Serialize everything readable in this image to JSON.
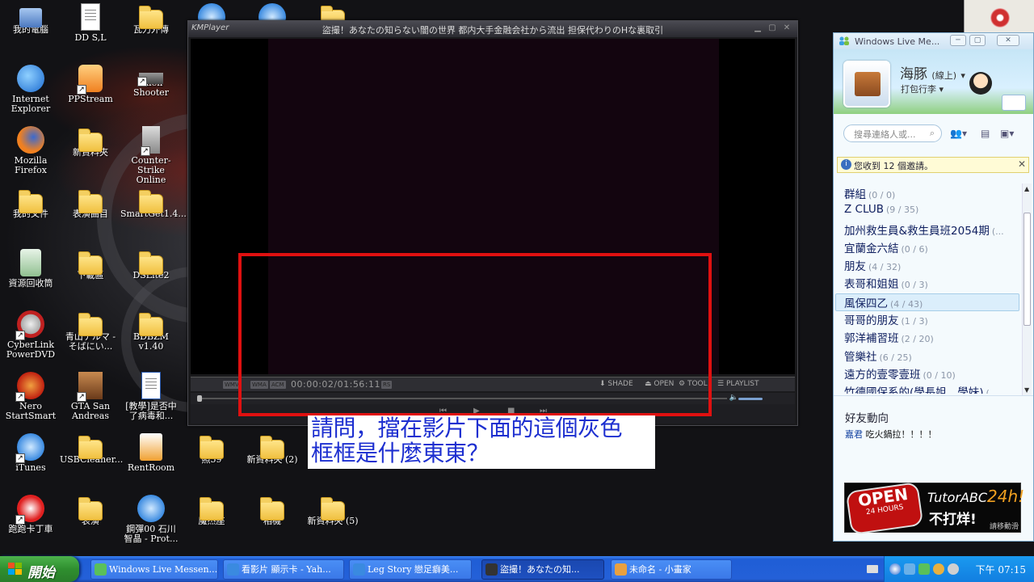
{
  "desktop": {
    "icons": [
      {
        "label": "我的電腦"
      },
      {
        "label": "DD S,L"
      },
      {
        "label": "瓦力外傳"
      },
      {
        "label": "Internet\nExplorer"
      },
      {
        "label": "PPStream"
      },
      {
        "label": "Alien Shooter"
      },
      {
        "label": "Mozilla\nFirefox"
      },
      {
        "label": "新資料夾"
      },
      {
        "label": "Counter-Strike\nOnline"
      },
      {
        "label": "我的文件"
      },
      {
        "label": "表演曲目"
      },
      {
        "label": "SmartGet1.4..."
      },
      {
        "label": "資源回收筒"
      },
      {
        "label": "下載區"
      },
      {
        "label": "DSLite2"
      },
      {
        "label": "CyberLink\nPowerDVD"
      },
      {
        "label": "青山テルマ -\nそばにい..."
      },
      {
        "label": "BDBZM v1.40"
      },
      {
        "label": "Nero\nStartSmart"
      },
      {
        "label": "GTA San\nAndreas"
      },
      {
        "label": "[教學]是否中\n了病毒和..."
      },
      {
        "label": "iTunes"
      },
      {
        "label": "USBCleaner..."
      },
      {
        "label": "RentRoom"
      },
      {
        "label": "照59"
      },
      {
        "label": "新資料夾 (2)"
      },
      {
        "label": "跑跑卡丁車"
      },
      {
        "label": "表演"
      },
      {
        "label": "鋼彈00 石川\n智晶 - Prot..."
      },
      {
        "label": "魔杰座"
      },
      {
        "label": "相機"
      },
      {
        "label": "新資料夾 (5)"
      }
    ]
  },
  "kmplayer": {
    "logo": "KMPlayer",
    "title": "盜撮！あなたの知らない闇の世界 都内大手金融会社から流出 担保代わりのHな裏取引",
    "tags": [
      "WMV",
      "WMA",
      "ACM"
    ],
    "time": "00:00:02/01:56:11",
    "tag_rs": "RS",
    "buttons": {
      "shade": "SHADE",
      "open": "OPEN",
      "tool": "TOOL",
      "playlist": "PLAYLIST"
    },
    "playback_position": 0.0003
  },
  "annotation": {
    "line1": "請問，擋在影片下面的這個灰色",
    "line2": "框框是什麼東東？",
    "color": "#e01010"
  },
  "messenger": {
    "title": "Windows Live Me...",
    "name": "海豚",
    "status_online": "(線上)",
    "personal_msg": "打包行李",
    "search_placeholder": "搜尋連絡人或...",
    "notice": "您收到 12 個邀請。",
    "groups": [
      {
        "name": "群組",
        "count": "(0 / 0)"
      },
      {
        "name": "Z CLUB",
        "count": "(9 / 35)"
      },
      {
        "name": "加州救生員&救生員班2054期",
        "count": "(..."
      },
      {
        "name": "宜蘭金六結",
        "count": "(0 / 6)"
      },
      {
        "name": "朋友",
        "count": "(4 / 32)"
      },
      {
        "name": "表哥和姐姐",
        "count": "(0 / 3)"
      },
      {
        "name": "風保四乙",
        "count": "(4 / 43)"
      },
      {
        "name": "哥哥的朋友",
        "count": "(1 / 3)"
      },
      {
        "name": "郭洋補習班",
        "count": "(2 / 20)"
      },
      {
        "name": "管樂社",
        "count": "(6 / 25)"
      },
      {
        "name": "遠方的壹零壹班",
        "count": "(0 / 10)"
      },
      {
        "name": "竹德國保系的(學長姐．學妹)",
        "count": "(..."
      }
    ],
    "selected_group": 6,
    "feed_title": "好友動向",
    "feed_user": "嘉君",
    "feed_text": "吃火鍋拉！！！！",
    "ad": {
      "open": "OPEN",
      "hours": "24 HOURS",
      "brand": "TutorABC",
      "h24": "24h!",
      "tagline": "不打烊!",
      "move": "請移動滑"
    }
  },
  "taskbar": {
    "start": "開始",
    "tasks": [
      {
        "label": "Windows Live Messen..."
      },
      {
        "label": "看影片 顯示卡 - Yah..."
      },
      {
        "label": "Leg Story 戀足癖美..."
      },
      {
        "label": "盜撮！あなたの知..."
      },
      {
        "label": "未命名 - 小畫家"
      }
    ],
    "active_task": 3,
    "clock": "下午 07:15"
  }
}
